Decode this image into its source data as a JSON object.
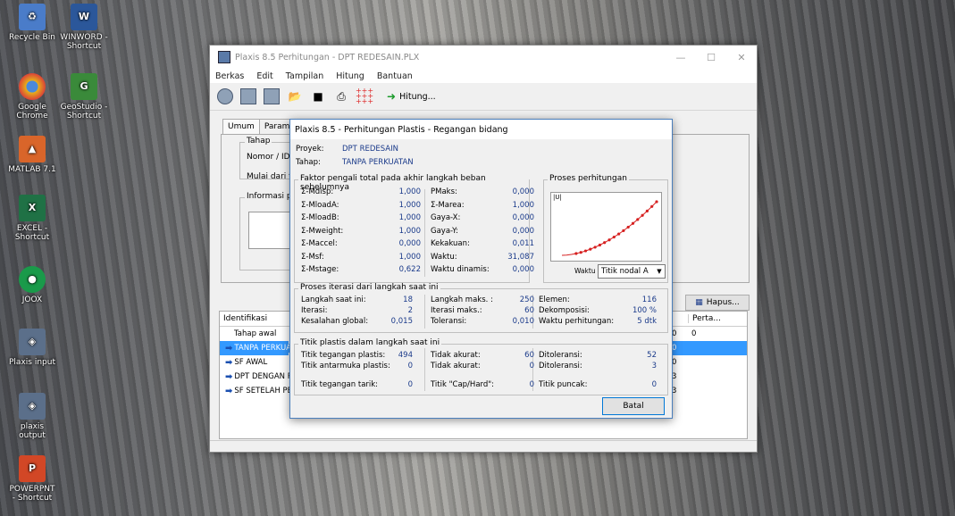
{
  "desktop": {
    "icons": [
      {
        "label": "Recycle Bin",
        "icon": "recycle-bin-icon",
        "color": "#4a7cc9"
      },
      {
        "label": "WINWORD - Shortcut",
        "icon": "word-icon",
        "color": "#2b579a"
      },
      {
        "label": "Google Chrome",
        "icon": "chrome-icon",
        "color": "#e5b01b"
      },
      {
        "label": "GeoStudio - Shortcut",
        "icon": "geostudio-icon",
        "color": "#3a8a3a"
      },
      {
        "label": "MATLAB 7.1",
        "icon": "matlab-icon",
        "color": "#d9652a"
      },
      {
        "label": "EXCEL - Shortcut",
        "icon": "excel-icon",
        "color": "#1f7145"
      },
      {
        "label": "JOOX",
        "icon": "joox-icon",
        "color": "#1a9a4a"
      },
      {
        "label": "Plaxis input",
        "icon": "plaxis-input-icon",
        "color": "#5b6f8a"
      },
      {
        "label": "plaxis output",
        "icon": "plaxis-output-icon",
        "color": "#5b6f8a"
      },
      {
        "label": "POWERPNT - Shortcut",
        "icon": "powerpoint-icon",
        "color": "#d24726"
      }
    ]
  },
  "main_window": {
    "title": "Plaxis 8.5 Perhitungan - DPT REDESAIN.PLX",
    "menu": [
      "Berkas",
      "Edit",
      "Tampilan",
      "Hitung",
      "Bantuan"
    ],
    "toolbar_run_label": "Hitung...",
    "tabs": [
      "Umum",
      "Parameter"
    ],
    "tahap_group": "Tahap",
    "nomor_label": "Nomor / ID.:",
    "mulai_label": "Mulai dari taha",
    "informasi_label": "Informasi perh",
    "hapus_label": "Hapus...",
    "list_header_identifikasi": "Identifikasi",
    "list_header_perta": "Perta...",
    "phases": [
      {
        "name": "Tahap awal",
        "c1": "0",
        "c2": "0",
        "arrow": false,
        "selected": false
      },
      {
        "name": "TANPA PERKUAT",
        "c1": "0",
        "c2": "",
        "arrow": true,
        "selected": true
      },
      {
        "name": "SF AWAL",
        "c1": "0",
        "c2": "",
        "arrow": true,
        "selected": false
      },
      {
        "name": "DPT DENGAN PE",
        "c1": "3",
        "c2": "",
        "arrow": true,
        "selected": false
      },
      {
        "name": "SF SETELAH PER",
        "c1": "3",
        "c2": "",
        "arrow": true,
        "selected": false
      }
    ]
  },
  "dialog": {
    "title": "Plaxis 8.5 - Perhitungan Plastis - Regangan bidang",
    "proyek_label": "Proyek:",
    "proyek_value": "DPT REDESAIN",
    "tahap_label": "Tahap:",
    "tahap_value": "TANPA PERKUATAN",
    "faktor_title": "Faktor pengali total pada akhir langkah beban sebelumnya",
    "faktor_left": [
      {
        "k": "Σ-Mdisp:",
        "v": "1,000"
      },
      {
        "k": "Σ-MloadA:",
        "v": "1,000"
      },
      {
        "k": "Σ-MloadB:",
        "v": "1,000"
      },
      {
        "k": "Σ-Mweight:",
        "v": "1,000"
      },
      {
        "k": "Σ-Maccel:",
        "v": "0,000"
      },
      {
        "k": "Σ-Msf:",
        "v": "1,000"
      },
      {
        "k": "Σ-Mstage:",
        "v": "0,622"
      }
    ],
    "faktor_right": [
      {
        "k": "PMaks:",
        "v": "0,000"
      },
      {
        "k": "Σ-Marea:",
        "v": "1,000"
      },
      {
        "k": "Gaya-X:",
        "v": "0,000"
      },
      {
        "k": "Gaya-Y:",
        "v": "0,000"
      },
      {
        "k": "Kekakuan:",
        "v": "0,011"
      },
      {
        "k": "Waktu:",
        "v": "31,087"
      },
      {
        "k": "Waktu dinamis:",
        "v": "0,000"
      }
    ],
    "proses_title": "Proses perhitungan",
    "graph_axis_label": "|U|",
    "waktu_label": "Waktu",
    "titik_select": "Titik nodal A",
    "iterasi_title": "Proses iterasi dari langkah saat ini",
    "iterasi_col1": [
      {
        "k": "Langkah saat ini:",
        "v": "18"
      },
      {
        "k": "Iterasi:",
        "v": "2"
      },
      {
        "k": "Kesalahan global:",
        "v": "0,015"
      }
    ],
    "iterasi_col2": [
      {
        "k": "Langkah maks. :",
        "v": "250"
      },
      {
        "k": "Iterasi maks.:",
        "v": "60"
      },
      {
        "k": "Toleransi:",
        "v": "0,010"
      }
    ],
    "iterasi_col3": [
      {
        "k": "Elemen:",
        "v": "116"
      },
      {
        "k": "Dekomposisi:",
        "v": "100 %"
      },
      {
        "k": "Waktu perhitungan:",
        "v": "5 dtk"
      }
    ],
    "titik_title": "Titik plastis dalam langkah saat ini",
    "titik_col1": [
      {
        "k": "Titik tegangan plastis:",
        "v": "494"
      },
      {
        "k": "Titik antarmuka plastis:",
        "v": "0"
      },
      {
        "k": "Titik tegangan tarik:",
        "v": "0"
      }
    ],
    "titik_col2": [
      {
        "k": "Tidak akurat:",
        "v": "60"
      },
      {
        "k": "Tidak akurat:",
        "v": "0"
      },
      {
        "k": "Titik \"Cap/Hard\":",
        "v": "0"
      }
    ],
    "titik_col3": [
      {
        "k": "Ditoleransi:",
        "v": "52"
      },
      {
        "k": "Ditoleransi:",
        "v": "3"
      },
      {
        "k": "Titik puncak:",
        "v": "0"
      }
    ],
    "batal_label": "Batal"
  }
}
